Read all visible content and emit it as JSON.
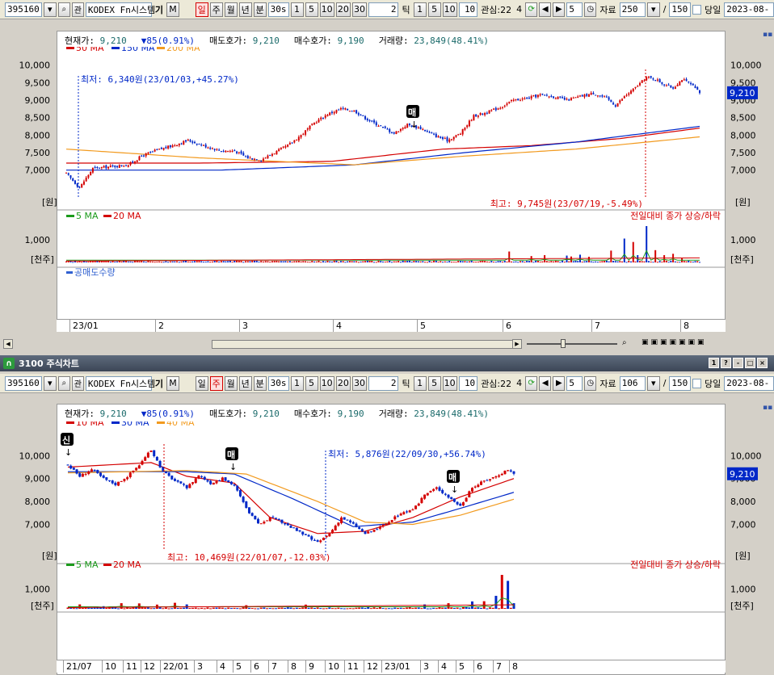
{
  "toolbar": {
    "code": "395160",
    "name": "KODEX Fn시스템",
    "name_extra": "기",
    "m_btn": "M",
    "period_tabs": [
      "일",
      "주",
      "월",
      "년",
      "분"
    ],
    "min_box": "30s",
    "num_btns": [
      "1",
      "5",
      "10",
      "20",
      "30"
    ],
    "tick_value": "2",
    "tick_label": "틱",
    "tick_btns": [
      "1",
      "5",
      "10"
    ],
    "tick_box": "10",
    "interest_label": "관심:22",
    "interest_extra": "4",
    "step_value": "5",
    "data_label": "자료",
    "slash": "/",
    "max_count": "150",
    "today_label": "당일",
    "date": "2023-08-",
    "search_icon": "magnifier-icon",
    "refresh_icon": "refresh-icon"
  },
  "chart1_toolbar": {
    "active_period": "일",
    "data_count": "250"
  },
  "chart2_toolbar": {
    "active_period": "주",
    "data_count": "106"
  },
  "info": {
    "current_label": "현재가:",
    "current_value": "9,210",
    "change_value": "85(0.91%)",
    "ask_label": "매도호가:",
    "ask_value": "9,210",
    "bid_label": "매수호가:",
    "bid_value": "9,190",
    "volume_label": "거래량:",
    "volume_value": "23,849(48.41%)"
  },
  "window2": {
    "title": "3100 주식차트",
    "btns": [
      "1",
      "?",
      "-",
      "□",
      "×"
    ]
  },
  "colors": {
    "up": "#d40000",
    "down": "#0028c8",
    "ma_red": "#d40000",
    "ma_blue": "#0028c8",
    "ma_orange": "#f29a1e",
    "ma_green": "#1a9a1a",
    "price_badge": "#0028c8"
  },
  "chart_data": [
    {
      "type": "candlestick",
      "panel": "daily-price",
      "legend": [
        "50 MA",
        "150 MA",
        "200 MA"
      ],
      "y_ticks": [
        "10,000",
        "9,500",
        "9,000",
        "8,500",
        "8,000",
        "7,500",
        "7,000"
      ],
      "y_unit": "[원]",
      "ylim": [
        6000,
        10200
      ],
      "x_labels": [
        "23/01",
        "2",
        "3",
        "4",
        "5",
        "6",
        "7",
        "8"
      ],
      "current_price_label": "9,210",
      "annotation_low": "최저: 6,340원(23/01/03,+45.27%)",
      "annotation_high": "최고: 9,745원(23/07/19,-5.49%)",
      "marker": "매",
      "anchors": [
        [
          0,
          6900
        ],
        [
          6,
          6500
        ],
        [
          12,
          7050
        ],
        [
          20,
          7100
        ],
        [
          28,
          7150
        ],
        [
          34,
          7400
        ],
        [
          40,
          7550
        ],
        [
          48,
          7700
        ],
        [
          55,
          7850
        ],
        [
          62,
          7700
        ],
        [
          70,
          7550
        ],
        [
          76,
          7550
        ],
        [
          82,
          7350
        ],
        [
          88,
          7300
        ],
        [
          94,
          7500
        ],
        [
          100,
          7700
        ],
        [
          106,
          8000
        ],
        [
          112,
          8350
        ],
        [
          118,
          8600
        ],
        [
          124,
          8750
        ],
        [
          130,
          8700
        ],
        [
          136,
          8450
        ],
        [
          142,
          8250
        ],
        [
          148,
          8050
        ],
        [
          154,
          8300
        ],
        [
          160,
          8200
        ],
        [
          166,
          8000
        ],
        [
          172,
          7850
        ],
        [
          178,
          8050
        ],
        [
          184,
          8550
        ],
        [
          190,
          8650
        ],
        [
          196,
          8800
        ],
        [
          202,
          9000
        ],
        [
          208,
          9050
        ],
        [
          214,
          9150
        ],
        [
          220,
          9100
        ],
        [
          226,
          9000
        ],
        [
          232,
          9100
        ],
        [
          238,
          9200
        ],
        [
          244,
          9050
        ],
        [
          248,
          8850
        ],
        [
          252,
          9100
        ],
        [
          256,
          9300
        ],
        [
          262,
          9650
        ],
        [
          266,
          9600
        ],
        [
          270,
          9450
        ],
        [
          274,
          9350
        ],
        [
          278,
          9600
        ],
        [
          282,
          9450
        ],
        [
          286,
          9210
        ]
      ],
      "ma50": [
        [
          0,
          7200
        ],
        [
          60,
          7200
        ],
        [
          120,
          7250
        ],
        [
          170,
          7600
        ],
        [
          210,
          7700
        ],
        [
          250,
          7900
        ],
        [
          286,
          8200
        ]
      ],
      "ma150": [
        [
          0,
          7000
        ],
        [
          70,
          7000
        ],
        [
          130,
          7150
        ],
        [
          180,
          7500
        ],
        [
          230,
          7800
        ],
        [
          286,
          8250
        ]
      ],
      "ma200": [
        [
          0,
          7600
        ],
        [
          60,
          7350
        ],
        [
          130,
          7150
        ],
        [
          180,
          7400
        ],
        [
          230,
          7600
        ],
        [
          286,
          7950
        ]
      ]
    },
    {
      "type": "bar",
      "panel": "daily-volume",
      "legend": [
        "5 MA",
        "20 MA"
      ],
      "legend_right": "전일대비 종가 상승/하락",
      "y_ticks": [
        "1,000"
      ],
      "y_unit": "[천주]",
      "short_sell_label": "공매도수량",
      "ylim": [
        0,
        1600
      ],
      "spikes": [
        [
          200,
          480
        ],
        [
          210,
          280
        ],
        [
          216,
          320
        ],
        [
          226,
          300
        ],
        [
          228,
          260
        ],
        [
          232,
          340
        ],
        [
          236,
          250
        ],
        [
          246,
          520
        ],
        [
          252,
          1050
        ],
        [
          256,
          900
        ],
        [
          258,
          320
        ],
        [
          262,
          1600
        ],
        [
          266,
          540
        ],
        [
          270,
          320
        ],
        [
          274,
          380
        ],
        [
          278,
          200
        ]
      ]
    },
    {
      "type": "candlestick",
      "panel": "weekly-price",
      "legend": [
        "10 MA",
        "30 MA",
        "40 MA"
      ],
      "y_ticks": [
        "10,000",
        "9,000",
        "8,000",
        "7,000"
      ],
      "y_unit": "[원]",
      "ylim": [
        5500,
        11000
      ],
      "x_labels": [
        "21/07",
        "10",
        "11",
        "12",
        "22/01",
        "3",
        "4",
        "5",
        "6",
        "7",
        "8",
        "9",
        "10",
        "11",
        "12",
        "23/01",
        "3",
        "4",
        "5",
        "6",
        "7",
        "8"
      ],
      "current_price_label": "9,210",
      "annotation_low": "최저: 5,876원(22/09/30,+56.74%)",
      "annotation_high": "최고: 10,469원(22/01/07,-12.03%)",
      "markers": [
        "신",
        "매",
        "매"
      ],
      "anchors": [
        [
          0,
          9600
        ],
        [
          4,
          9100
        ],
        [
          8,
          9400
        ],
        [
          12,
          9000
        ],
        [
          16,
          8750
        ],
        [
          20,
          9100
        ],
        [
          24,
          9600
        ],
        [
          28,
          10250
        ],
        [
          32,
          9300
        ],
        [
          36,
          8900
        ],
        [
          40,
          8600
        ],
        [
          44,
          9150
        ],
        [
          48,
          8800
        ],
        [
          52,
          9000
        ],
        [
          56,
          8700
        ],
        [
          60,
          7700
        ],
        [
          64,
          7000
        ],
        [
          68,
          7300
        ],
        [
          72,
          7100
        ],
        [
          76,
          6800
        ],
        [
          80,
          6500
        ],
        [
          84,
          6200
        ],
        [
          88,
          6600
        ],
        [
          92,
          7300
        ],
        [
          96,
          7000
        ],
        [
          100,
          6600
        ],
        [
          104,
          6800
        ],
        [
          108,
          7100
        ],
        [
          112,
          7500
        ],
        [
          116,
          7600
        ],
        [
          120,
          8300
        ],
        [
          124,
          8600
        ],
        [
          128,
          8200
        ],
        [
          132,
          7800
        ],
        [
          136,
          8600
        ],
        [
          140,
          8900
        ],
        [
          144,
          9100
        ],
        [
          148,
          9400
        ],
        [
          150,
          9210
        ]
      ],
      "ma10": [
        [
          0,
          9500
        ],
        [
          28,
          9700
        ],
        [
          40,
          9100
        ],
        [
          56,
          8800
        ],
        [
          68,
          7300
        ],
        [
          84,
          6600
        ],
        [
          100,
          6700
        ],
        [
          116,
          7300
        ],
        [
          132,
          8200
        ],
        [
          150,
          9000
        ]
      ],
      "ma30": [
        [
          0,
          9300
        ],
        [
          40,
          9300
        ],
        [
          56,
          9200
        ],
        [
          76,
          8100
        ],
        [
          96,
          6900
        ],
        [
          116,
          7100
        ],
        [
          132,
          7700
        ],
        [
          150,
          8400
        ]
      ],
      "ma40": [
        [
          0,
          9250
        ],
        [
          40,
          9350
        ],
        [
          60,
          9200
        ],
        [
          84,
          8000
        ],
        [
          100,
          7100
        ],
        [
          116,
          7000
        ],
        [
          132,
          7400
        ],
        [
          150,
          8100
        ]
      ]
    },
    {
      "type": "bar",
      "panel": "weekly-volume",
      "legend": [
        "5 MA",
        "20 MA"
      ],
      "legend_right": "전일대비 종가 상승/하락",
      "y_ticks": [
        "1,000"
      ],
      "y_unit": "[천주]",
      "ylim": [
        0,
        1700
      ],
      "spikes": [
        [
          4,
          220
        ],
        [
          12,
          130
        ],
        [
          18,
          280
        ],
        [
          24,
          270
        ],
        [
          30,
          210
        ],
        [
          36,
          300
        ],
        [
          40,
          220
        ],
        [
          60,
          180
        ],
        [
          80,
          210
        ],
        [
          120,
          220
        ],
        [
          128,
          280
        ],
        [
          136,
          370
        ],
        [
          140,
          380
        ],
        [
          144,
          650
        ],
        [
          146,
          1700
        ],
        [
          148,
          1400
        ],
        [
          150,
          280
        ]
      ]
    }
  ]
}
